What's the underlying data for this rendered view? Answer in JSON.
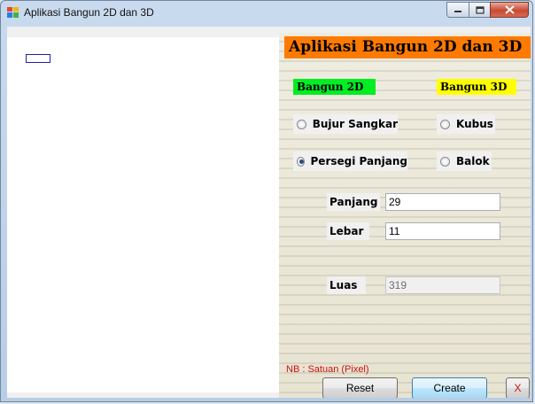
{
  "window": {
    "title": "Aplikasi Bangun 2D dan 3D"
  },
  "panel": {
    "header": "Aplikasi Bangun 2D dan 3D",
    "group_2d": "Bangun 2D",
    "group_3d": "Bangun 3D",
    "radios": {
      "bujur_sangkar": {
        "label": "Bujur Sangkar",
        "checked": false
      },
      "persegi_panjang": {
        "label": "Persegi Panjang",
        "checked": true
      },
      "kubus": {
        "label": "Kubus",
        "checked": false
      },
      "balok": {
        "label": "Balok",
        "checked": false
      }
    },
    "fields": {
      "panjang": {
        "label": "Panjang",
        "value": "29"
      },
      "lebar": {
        "label": "Lebar",
        "value": "11"
      },
      "luas": {
        "label": "Luas",
        "value": "319"
      }
    },
    "note": "NB : Satuan (Pixel)",
    "buttons": {
      "reset": "Reset",
      "create": "Create",
      "close": "X"
    }
  },
  "colors": {
    "header_bg": "#ff7a00",
    "tag_2d_bg": "#00ee22",
    "tag_3d_bg": "#ffff00",
    "note_color": "#d01010"
  },
  "icons": {
    "app": "app-icon",
    "minimize": "minimize-icon",
    "maximize": "maximize-icon",
    "close": "close-icon"
  }
}
